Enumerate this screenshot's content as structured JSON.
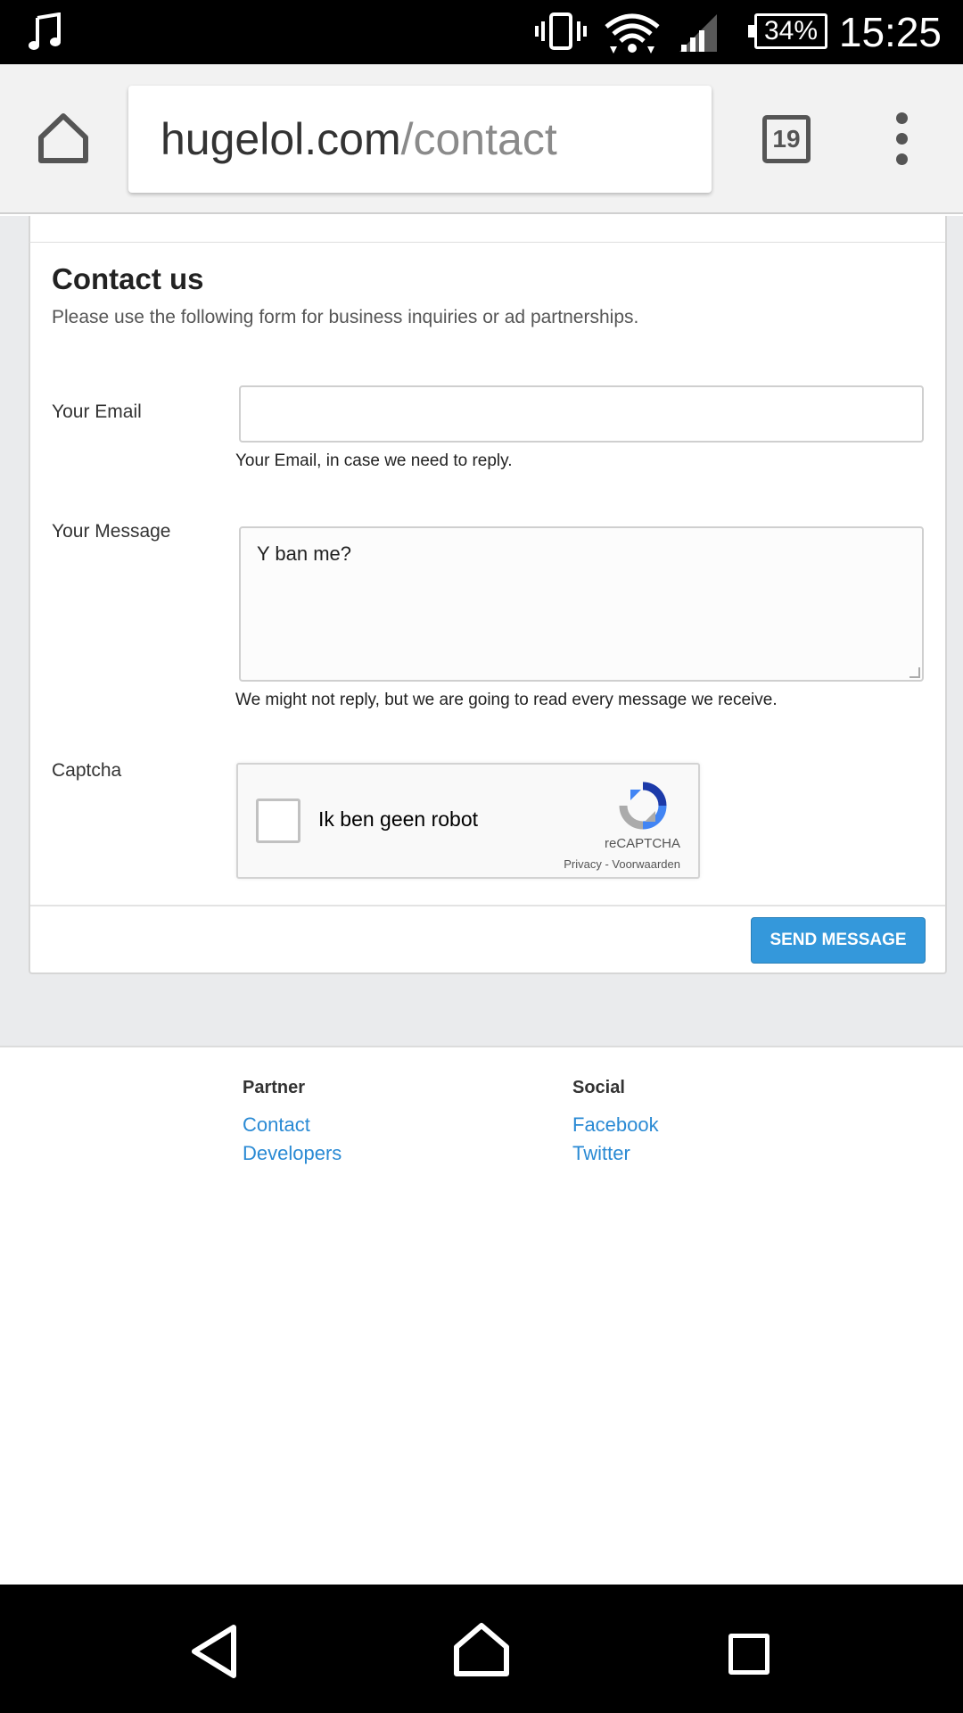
{
  "status_bar": {
    "battery": "34%",
    "time": "15:25",
    "icons": [
      "music-note-icon",
      "vibrate-icon",
      "wifi-icon",
      "signal-icon",
      "battery-icon"
    ]
  },
  "browser": {
    "url_host": "hugelol.com",
    "url_path": "/contact",
    "tab_count": "19",
    "icons": [
      "home-icon",
      "tabs-icon",
      "overflow-menu-icon"
    ]
  },
  "form": {
    "title": "Contact us",
    "subtitle": "Please use the following form for business inquiries or ad partnerships.",
    "email_label": "Your Email",
    "email_value": "",
    "email_help": "Your Email, in case we need to reply.",
    "message_label": "Your Message",
    "message_value": "Y ban me?",
    "message_help": "We might not reply, but we are going to read every message we receive.",
    "captcha_label": "Captcha",
    "captcha": {
      "checkbox_text": "Ik ben geen robot",
      "brand": "reCAPTCHA",
      "links": "Privacy - Voorwaarden",
      "checked": false
    },
    "submit_label": "SEND MESSAGE",
    "accent_color": "#3498db"
  },
  "footer": {
    "columns": [
      {
        "heading": "Partner",
        "links": [
          "Contact",
          "Developers"
        ]
      },
      {
        "heading": "Social",
        "links": [
          "Facebook",
          "Twitter"
        ]
      }
    ],
    "link_color": "#2a8ad4"
  },
  "nav_bar": {
    "icons": [
      "back-icon",
      "home-icon",
      "recents-icon"
    ]
  }
}
